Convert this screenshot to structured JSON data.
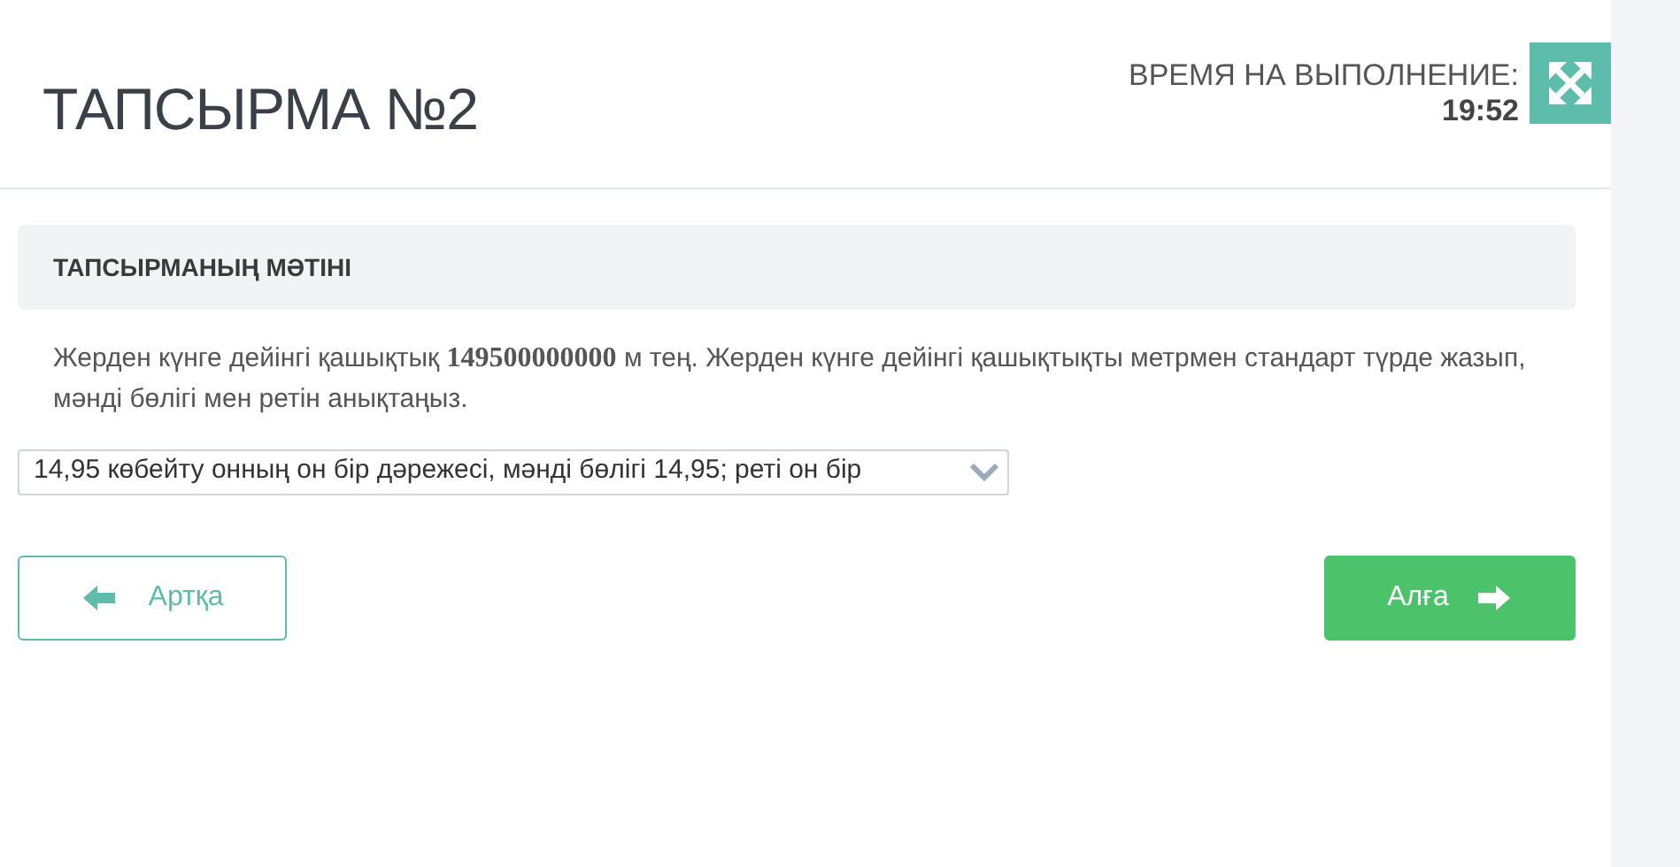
{
  "header": {
    "title": "ТАПСЫРМА №2",
    "timer_label": "ВРЕМЯ НА ВЫПОЛНЕНИЕ:",
    "timer_value": "19:52"
  },
  "task": {
    "heading": "ТАПСЫРМАНЫҢ МӘТІНІ",
    "text": "Жерден күнге дейінгі қашықтық **149500000000** м тең. Жерден күнге дейінгі қашықтықты метрмен стандарт түрде жазып, мәнді бөлігі мен ретін анықтаңыз."
  },
  "answer": {
    "value": "14,95 көбейту онның он бір дәрежесі, мәнді бөлігі 14,95; реті он бір"
  },
  "buttons": [
    {
      "kind": "back",
      "label": "Артқа"
    },
    {
      "kind": "next",
      "label": "Алға"
    }
  ]
}
